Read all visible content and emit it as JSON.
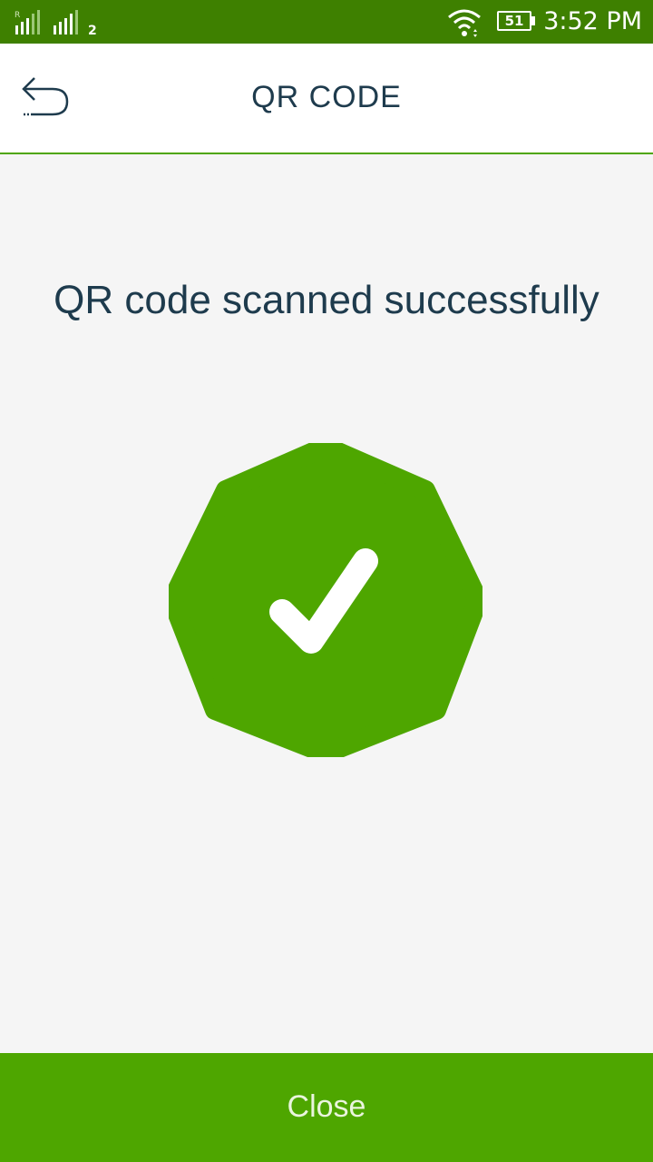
{
  "status_bar": {
    "sim2_label": "2",
    "battery_level": "51",
    "time": "3:52 PM"
  },
  "header": {
    "title": "QR CODE",
    "back_icon": "back-arrow-icon"
  },
  "main": {
    "message": "QR code scanned successfully",
    "badge_icon": "success-check-icon"
  },
  "footer": {
    "close_label": "Close"
  },
  "colors": {
    "status_bar": "#3e8000",
    "accent_green": "#4ea600",
    "text_dark": "#1e3b4d",
    "background": "#f5f5f5"
  }
}
